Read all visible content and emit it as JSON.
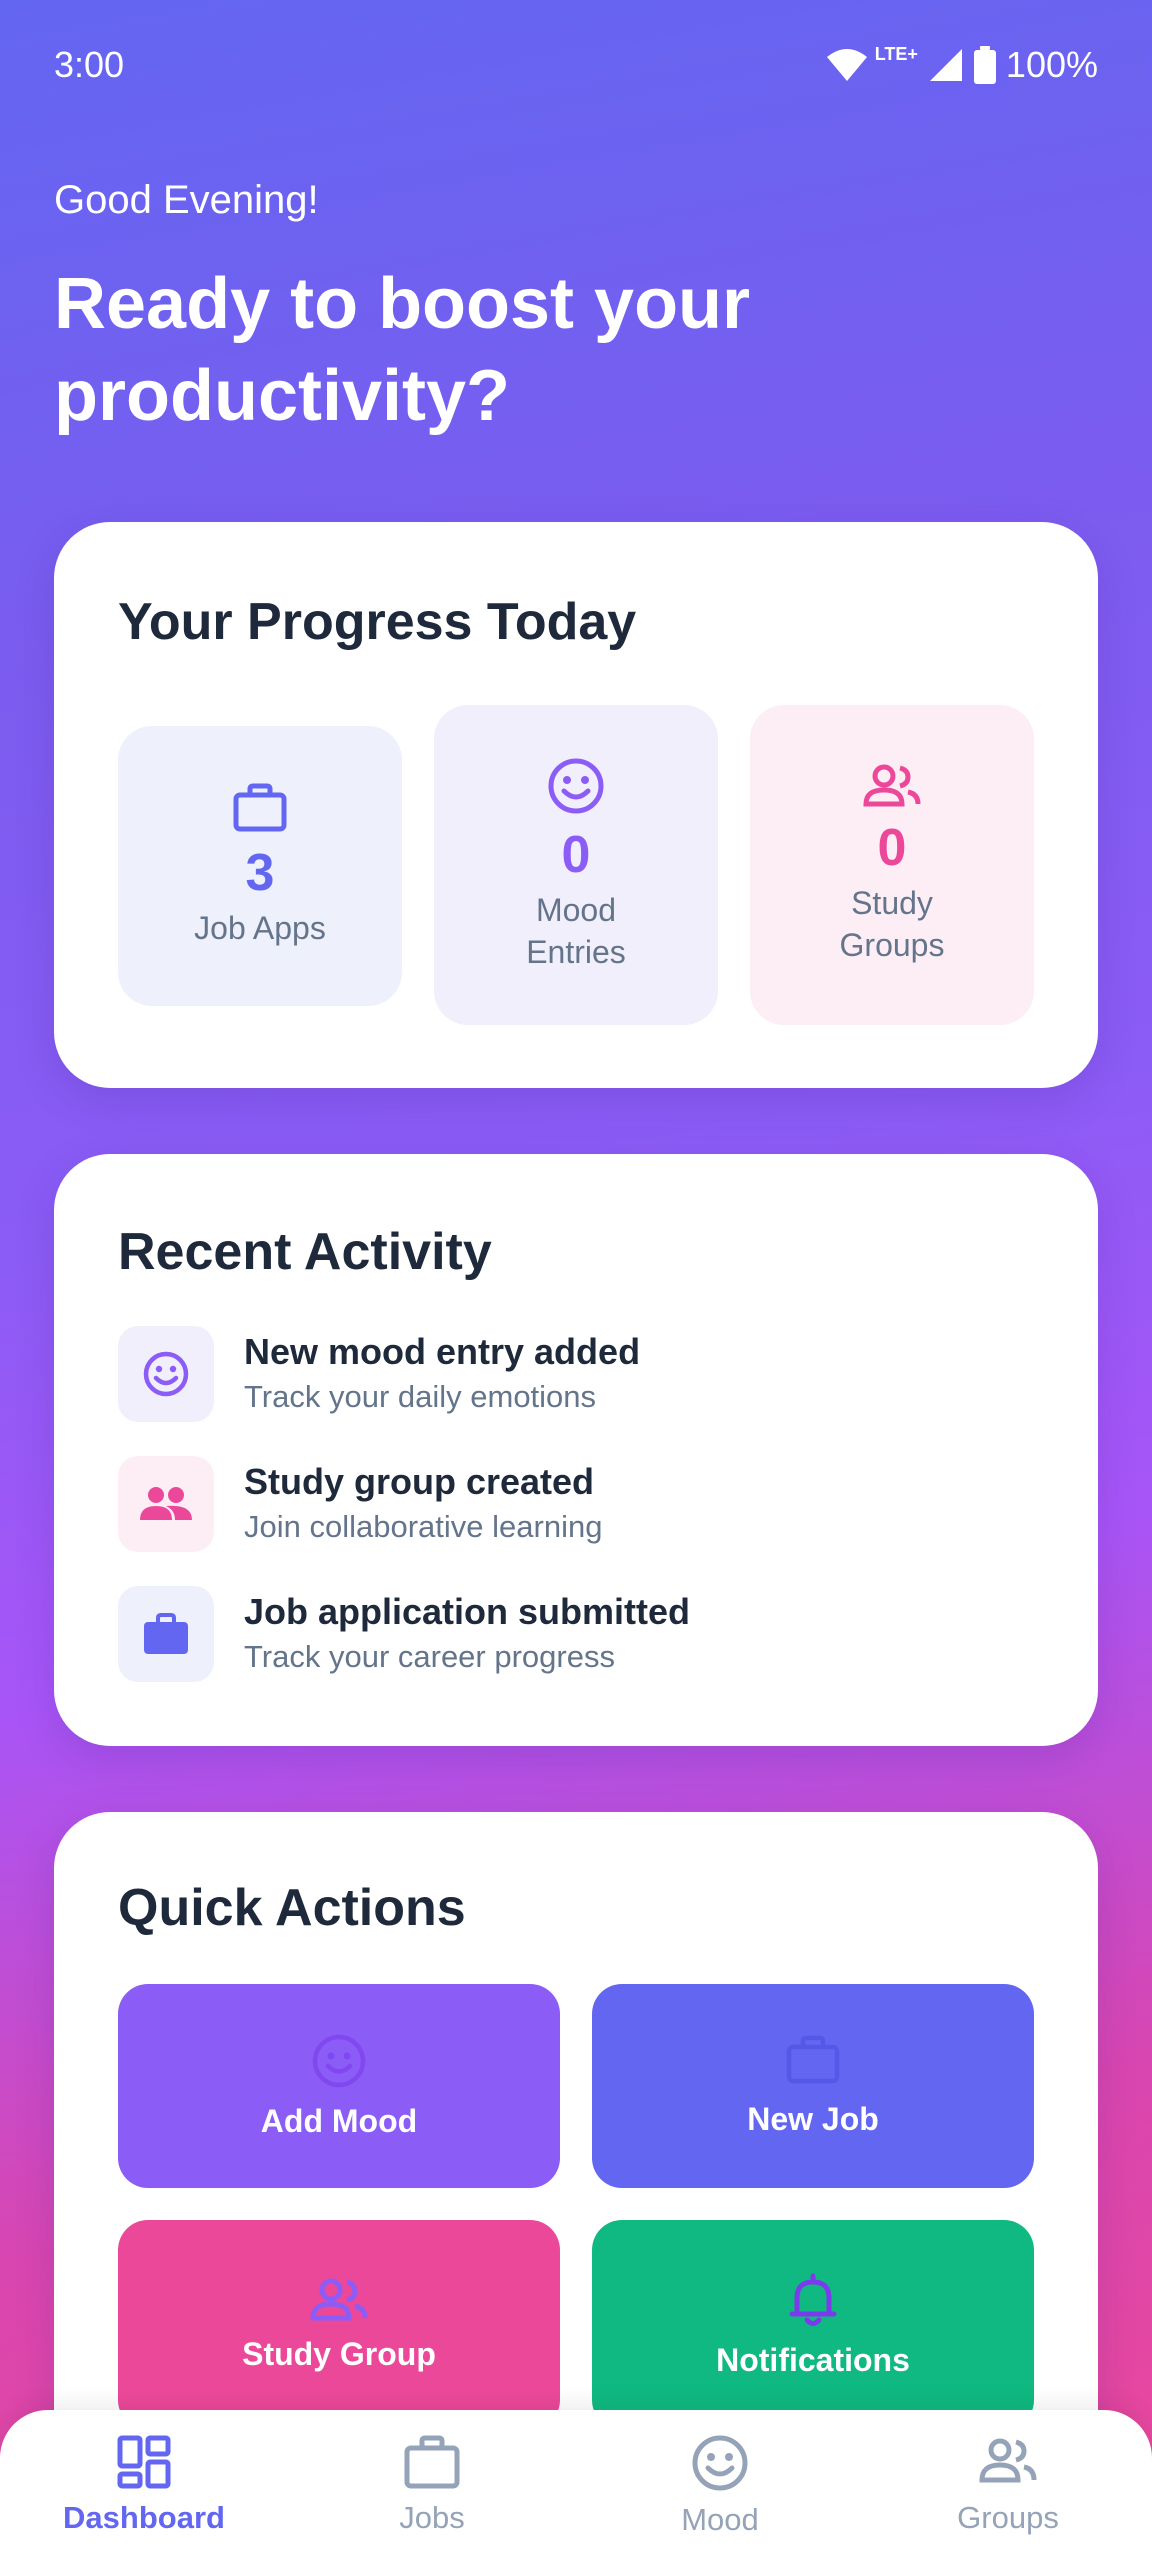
{
  "status_bar": {
    "time": "3:00",
    "network": "LTE+",
    "battery": "100%"
  },
  "greeting": {
    "small": "Good Evening!",
    "headline": "Ready to boost your productivity?"
  },
  "progress": {
    "title": "Your Progress Today",
    "tiles": [
      {
        "icon": "briefcase-icon",
        "value": "3",
        "label": "Job Apps",
        "color": "#6366f1",
        "bg": "#eef0fb"
      },
      {
        "icon": "smiley-icon",
        "value": "0",
        "label": "Mood Entries",
        "color": "#8b5cf6",
        "bg": "#f1effb"
      },
      {
        "icon": "people-icon",
        "value": "0",
        "label": "Study Groups",
        "color": "#ec4899",
        "bg": "#fdeef6"
      }
    ]
  },
  "activity": {
    "title": "Recent Activity",
    "items": [
      {
        "icon": "smiley-icon",
        "title": "New mood entry added",
        "subtitle": "Track your daily emotions"
      },
      {
        "icon": "people-icon",
        "title": "Study group created",
        "subtitle": "Join collaborative learning"
      },
      {
        "icon": "briefcase-icon",
        "title": "Job application submitted",
        "subtitle": "Track your career progress"
      }
    ]
  },
  "quick_actions": {
    "title": "Quick Actions",
    "buttons": [
      {
        "icon": "smiley-icon",
        "label": "Add Mood",
        "color": "#8b5cf6"
      },
      {
        "icon": "briefcase-icon",
        "label": "New Job",
        "color": "#6366f1"
      },
      {
        "icon": "people-icon",
        "label": "Study Group",
        "color": "#ec4899"
      },
      {
        "icon": "bell-icon",
        "label": "Notifications",
        "color": "#10b981"
      }
    ]
  },
  "bottom_nav": {
    "items": [
      {
        "icon": "dashboard-icon",
        "label": "Dashboard",
        "active": true
      },
      {
        "icon": "briefcase-icon",
        "label": "Jobs",
        "active": false
      },
      {
        "icon": "smiley-icon",
        "label": "Mood",
        "active": false
      },
      {
        "icon": "people-icon",
        "label": "Groups",
        "active": false
      }
    ]
  }
}
